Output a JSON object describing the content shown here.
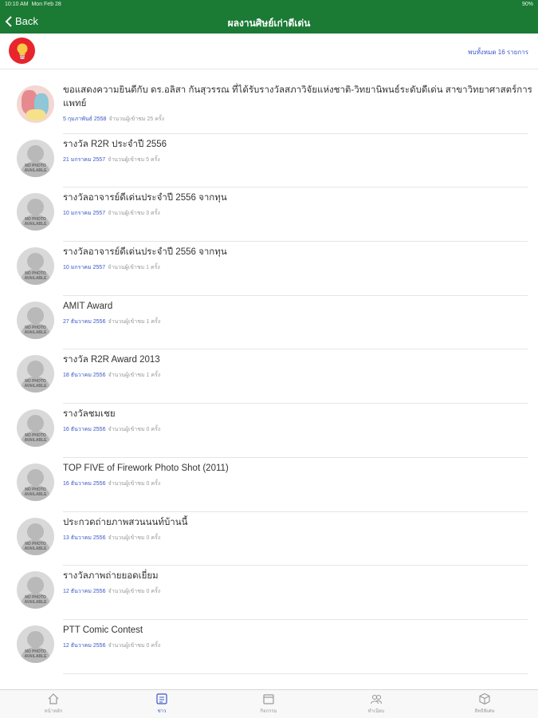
{
  "status": {
    "time": "10:10 AM",
    "date": "Mon Feb 28",
    "battery": "90%"
  },
  "nav": {
    "back_label": "Back",
    "title": "ผลงานศิษย์เก่าดีเด่น"
  },
  "header": {
    "count_text": "พบทั้งหมด 16 รายการ"
  },
  "items": [
    {
      "title": "ขอแสดงความยินดีกับ ดร.อลิสา กันสุวรรณ ที่ได้รับรางวัลสภาวิจัยแห่งชาติ-วิทยานิพนธ์ระดับดีเด่น สาขาวิทยาศาสตร์การแพทย์",
      "date": "5 กุมภาพันธ์ 2558",
      "views": "จำนวนผู้เข้าชม 25 ครั้ง"
    },
    {
      "title": "รางวัล R2R ประจำปี 2556",
      "date": "21 มกราคม 2557",
      "views": "จำนวนผู้เข้าชม 5 ครั้ง"
    },
    {
      "title": "รางวัลอาจารย์ดีเด่นประจำปี 2556 จากทุน",
      "date": "10 มกราคม 2557",
      "views": "จำนวนผู้เข้าชม 3 ครั้ง"
    },
    {
      "title": "รางวัลอาจารย์ดีเด่นประจำปี 2556 จากทุน",
      "date": "10 มกราคม 2557",
      "views": "จำนวนผู้เข้าชม 1 ครั้ง"
    },
    {
      "title": "AMIT Award",
      "date": "27 ธันวาคม 2556",
      "views": "จำนวนผู้เข้าชม 1 ครั้ง"
    },
    {
      "title": "รางวัล R2R Award 2013",
      "date": "18 ธันวาคม 2556",
      "views": "จำนวนผู้เข้าชม 1 ครั้ง"
    },
    {
      "title": "รางวัลชมเชย",
      "date": "16 ธันวาคม 2556",
      "views": "จำนวนผู้เข้าชม 0 ครั้ง"
    },
    {
      "title": "TOP FIVE of Firework Photo Shot (2011)",
      "date": "16 ธันวาคม 2556",
      "views": "จำนวนผู้เข้าชม 0 ครั้ง"
    },
    {
      "title": "ประกวดถ่ายภาพสวนนนท์บ้านนี้",
      "date": "13 ธันวาคม 2556",
      "views": "จำนวนผู้เข้าชม 0 ครั้ง"
    },
    {
      "title": "รางวัลภาพถ่ายยอดเยี่ยม",
      "date": "12 ธันวาคม 2556",
      "views": "จำนวนผู้เข้าชม 0 ครั้ง"
    },
    {
      "title": "PTT Comic Contest",
      "date": "12 ธันวาคม 2556",
      "views": "จำนวนผู้เข้าชม 0 ครั้ง"
    }
  ],
  "no_photo_text": "NO PHOTO AVAILABLE",
  "tabs": [
    {
      "label": "หน้าหลัก",
      "icon": "home-icon"
    },
    {
      "label": "ข่าว",
      "icon": "news-icon"
    },
    {
      "label": "กิจกรรม",
      "icon": "calendar-icon"
    },
    {
      "label": "ทำเนียบ",
      "icon": "people-icon"
    },
    {
      "label": "สิทธิพิเศษ",
      "icon": "box-icon"
    }
  ],
  "colors": {
    "header": "#1b7a34",
    "accent": "#3a56c8",
    "bulb": "#e8252c"
  }
}
